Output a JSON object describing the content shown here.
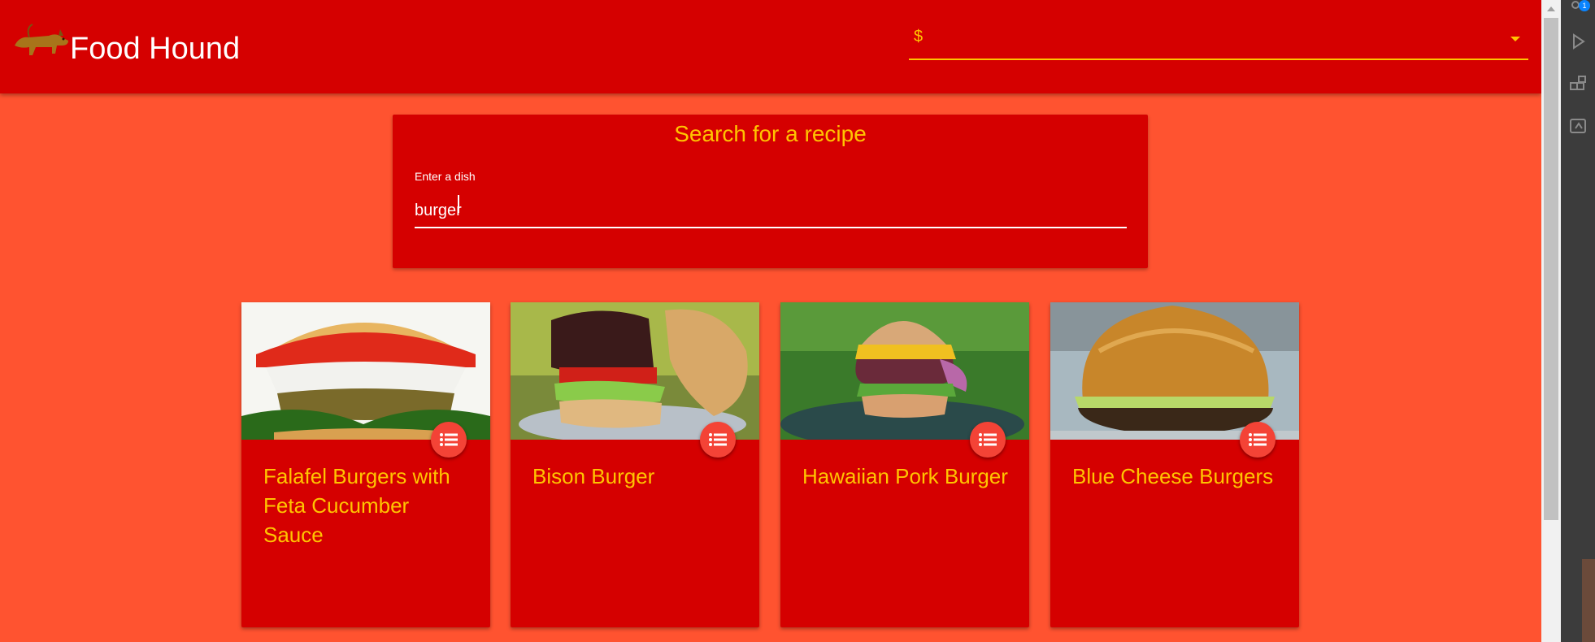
{
  "app": {
    "title": "Food Hound",
    "logo_icon": "hound-dog-logo-icon"
  },
  "header": {
    "currency_value": "$",
    "currency_icon": "dropdown-caret-icon"
  },
  "search": {
    "title": "Search for a recipe",
    "field_label": "Enter a dish",
    "value": "burger"
  },
  "recipes": [
    {
      "title": "Falafel Burgers with Feta Cucumber Sauce",
      "action_icon": "list-icon"
    },
    {
      "title": "Bison Burger",
      "action_icon": "list-icon"
    },
    {
      "title": "Hawaiian Pork Burger",
      "action_icon": "list-icon"
    },
    {
      "title": "Blue Cheese Burgers",
      "action_icon": "list-icon"
    }
  ],
  "side_panel": {
    "notification_count": "1",
    "icons": [
      "account-icon",
      "run-debug-icon",
      "extensions-icon",
      "remote-icon"
    ]
  },
  "colors": {
    "page_background": "#ff5330",
    "appbar": "#d50000",
    "card": "#d50000",
    "accent": "#ffc400",
    "fab": "#f44336"
  }
}
